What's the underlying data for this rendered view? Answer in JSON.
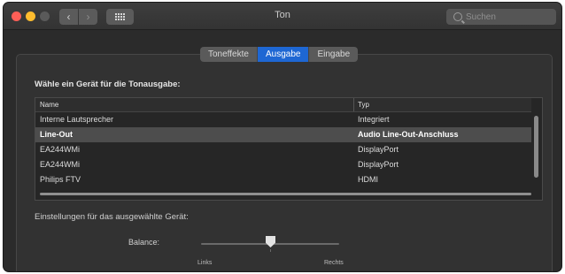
{
  "window": {
    "title": "Ton"
  },
  "search": {
    "placeholder": "Suchen"
  },
  "tabs": [
    {
      "label": "Toneffekte",
      "active": false
    },
    {
      "label": "Ausgabe",
      "active": true
    },
    {
      "label": "Eingabe",
      "active": false
    }
  ],
  "output": {
    "prompt": "Wähle ein Gerät für die Tonausgabe:",
    "columns": {
      "name": "Name",
      "type": "Typ"
    },
    "devices": [
      {
        "name": "Interne Lautsprecher",
        "type": "Integriert",
        "selected": false
      },
      {
        "name": "Line-Out",
        "type": "Audio Line-Out-Anschluss",
        "selected": true
      },
      {
        "name": "EA244WMi",
        "type": "DisplayPort",
        "selected": false
      },
      {
        "name": "EA244WMi",
        "type": "DisplayPort",
        "selected": false
      },
      {
        "name": "Philips FTV",
        "type": "HDMI",
        "selected": false
      }
    ]
  },
  "settings": {
    "label": "Einstellungen für das ausgewählte Gerät:",
    "balance": {
      "label": "Balance:",
      "left": "Links",
      "right": "Rechts",
      "value": 0.5
    }
  },
  "colors": {
    "accent": "#1e67d3",
    "selected_row": "#4d4d4d"
  }
}
